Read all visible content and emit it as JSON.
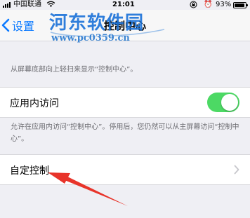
{
  "status_bar": {
    "carrier": "中国联通",
    "time": "21:01",
    "battery_percent": "93%",
    "battery_level": 0.93,
    "icons": [
      "signal-icon",
      "wifi-icon",
      "orientation-lock-icon",
      "alarm-icon",
      "battery-icon"
    ]
  },
  "nav": {
    "back_label": "设置",
    "title": "控制中心"
  },
  "watermark": {
    "title": "河东软件园",
    "url": "www.pc0359.cn"
  },
  "sections": {
    "intro_text": "从屏幕底部向上轻扫来显示“控制中心”。",
    "access_label": "应用内访问",
    "access_enabled": true,
    "access_footer": "允许在应用内访问“控制中心”。停用后，您仍然可以从主屏幕访问“控制中心”。",
    "customize_label": "自定控制"
  },
  "colors": {
    "ios_blue": "#0a7aff",
    "toggle_on": "#4cd964",
    "annotation_arrow": "#e8342a",
    "watermark_blue": "#1a72d8"
  }
}
